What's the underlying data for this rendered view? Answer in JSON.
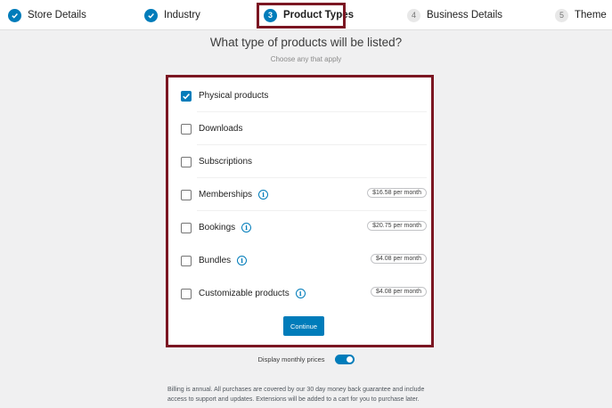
{
  "stepper": {
    "steps": [
      {
        "label": "Store Details",
        "state": "done",
        "number": ""
      },
      {
        "label": "Industry",
        "state": "done",
        "number": ""
      },
      {
        "label": "Product Types",
        "state": "active",
        "number": "3"
      },
      {
        "label": "Business Details",
        "state": "todo",
        "number": "4"
      },
      {
        "label": "Theme",
        "state": "todo",
        "number": "5"
      }
    ]
  },
  "heading": {
    "title": "What type of products will be listed?",
    "subtitle": "Choose any that apply"
  },
  "products": [
    {
      "label": "Physical products",
      "checked": true,
      "info": false,
      "price": ""
    },
    {
      "label": "Downloads",
      "checked": false,
      "info": false,
      "price": ""
    },
    {
      "label": "Subscriptions",
      "checked": false,
      "info": false,
      "price": ""
    },
    {
      "label": "Memberships",
      "checked": false,
      "info": true,
      "price": "$16.58 per month"
    },
    {
      "label": "Bookings",
      "checked": false,
      "info": true,
      "price": "$20.75 per month"
    },
    {
      "label": "Bundles",
      "checked": false,
      "info": true,
      "price": "$4.08 per month"
    },
    {
      "label": "Customizable products",
      "checked": false,
      "info": true,
      "price": "$4.08 per month"
    }
  ],
  "continue_label": "Continue",
  "toggle": {
    "label": "Display monthly prices",
    "on": true
  },
  "billing_note": "Billing is annual. All purchases are covered by our 30 day money back guarantee and include access to support and updates. Extensions will be added to a cart for you to purchase later.",
  "colors": {
    "accent": "#007cba",
    "highlight": "#7b1622"
  }
}
